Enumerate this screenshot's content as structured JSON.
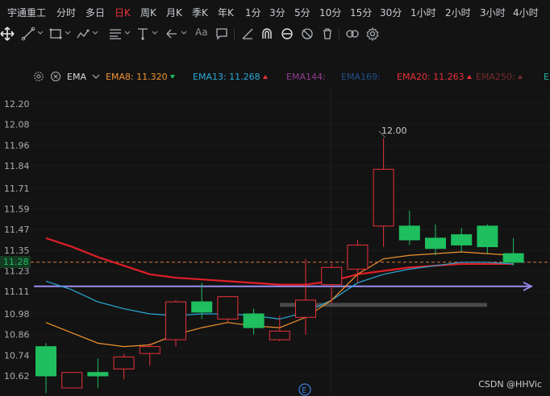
{
  "timeframes": [
    {
      "label": "宇通重工",
      "active": false
    },
    {
      "label": "分时",
      "active": false
    },
    {
      "label": "多日",
      "active": false
    },
    {
      "label": "日K",
      "active": true
    },
    {
      "label": "周K",
      "active": false
    },
    {
      "label": "月K",
      "active": false
    },
    {
      "label": "季K",
      "active": false
    },
    {
      "label": "年K",
      "active": false
    },
    {
      "label": "1分",
      "active": false
    },
    {
      "label": "3分",
      "active": false
    },
    {
      "label": "5分",
      "active": false
    },
    {
      "label": "10分",
      "active": false
    },
    {
      "label": "15分",
      "active": false
    },
    {
      "label": "30分",
      "active": false
    },
    {
      "label": "1小时",
      "active": false
    },
    {
      "label": "2小时",
      "active": false
    },
    {
      "label": "3小时",
      "active": false
    },
    {
      "label": "4小时",
      "active": false
    }
  ],
  "toolbar": {
    "tools": [
      "move-icon",
      "trend-line-icon",
      "rectangle-icon",
      "fibonacci-icon",
      "parallel-channel-icon",
      "price-line-icon",
      "arrow-left-icon",
      "text-tool-icon",
      "comment-icon",
      "ruler-icon",
      "magnet-icon",
      "link-icon",
      "hide-drawings-icon",
      "delete-icon",
      "overlay-icon",
      "settings-icon"
    ],
    "text_label": "Aa"
  },
  "legend": {
    "indicator": "EMA",
    "items": [
      {
        "name": "EMA8:",
        "value": "11.320",
        "trend": "down",
        "color": "#f0922e"
      },
      {
        "name": "EMA13:",
        "value": "11.268",
        "trend": "up",
        "color": "#29a9d8"
      },
      {
        "name": "EMA144:",
        "value": "",
        "trend": "",
        "color": "#8e3f8f"
      },
      {
        "name": "EMA169:",
        "value": "",
        "trend": "",
        "color": "#1f4f8a"
      },
      {
        "name": "EMA20:",
        "value": "11.263",
        "trend": "up",
        "color": "#e8313a"
      },
      {
        "name": "EMA250:",
        "value": "",
        "trend": "",
        "color": "#7a2a2a"
      },
      {
        "name": "E",
        "value": "",
        "trend": "",
        "color": "#29b3a3"
      }
    ]
  },
  "current_price": "11.28",
  "watermark": "CSDN @HHVic",
  "colors": {
    "up": "#e8313a",
    "down": "#1fbf5f",
    "background": "#131313",
    "grid": "#1f1f1f"
  },
  "chart_data": {
    "type": "candlestick",
    "y_ticks": [
      "12.20",
      "12.08",
      "11.96",
      "11.84",
      "11.71",
      "11.59",
      "11.47",
      "11.35",
      "11.23",
      "11.11",
      "10.98",
      "10.86",
      "10.74",
      "10.62"
    ],
    "high_marker": "12.00",
    "candles": [
      {
        "o": 10.62,
        "h": 10.81,
        "l": 10.52,
        "c": 10.79,
        "dir": "down"
      },
      {
        "o": 10.55,
        "h": 10.64,
        "l": 10.55,
        "c": 10.64,
        "dir": "up"
      },
      {
        "o": 10.62,
        "h": 10.72,
        "l": 10.55,
        "c": 10.64,
        "dir": "down"
      },
      {
        "o": 10.66,
        "h": 10.75,
        "l": 10.6,
        "c": 10.73,
        "dir": "up"
      },
      {
        "o": 10.75,
        "h": 10.81,
        "l": 10.68,
        "c": 10.79,
        "dir": "up"
      },
      {
        "o": 10.83,
        "h": 11.06,
        "l": 10.79,
        "c": 11.05,
        "dir": "up"
      },
      {
        "o": 11.05,
        "h": 11.16,
        "l": 10.95,
        "c": 10.99,
        "dir": "down"
      },
      {
        "o": 10.95,
        "h": 11.08,
        "l": 10.93,
        "c": 11.08,
        "dir": "up"
      },
      {
        "o": 10.98,
        "h": 11.01,
        "l": 10.86,
        "c": 10.9,
        "dir": "down"
      },
      {
        "o": 10.83,
        "h": 10.97,
        "l": 10.82,
        "c": 10.88,
        "dir": "up"
      },
      {
        "o": 10.96,
        "h": 11.3,
        "l": 10.86,
        "c": 11.06,
        "dir": "up"
      },
      {
        "o": 11.15,
        "h": 11.27,
        "l": 11.04,
        "c": 11.25,
        "dir": "up"
      },
      {
        "o": 11.24,
        "h": 11.41,
        "l": 11.16,
        "c": 11.38,
        "dir": "up"
      },
      {
        "o": 11.49,
        "h": 12.0,
        "l": 11.37,
        "c": 11.82,
        "dir": "up"
      },
      {
        "o": 11.49,
        "h": 11.58,
        "l": 11.38,
        "c": 11.41,
        "dir": "down"
      },
      {
        "o": 11.42,
        "h": 11.5,
        "l": 11.32,
        "c": 11.36,
        "dir": "down"
      },
      {
        "o": 11.44,
        "h": 11.48,
        "l": 11.34,
        "c": 11.38,
        "dir": "down"
      },
      {
        "o": 11.49,
        "h": 11.5,
        "l": 11.33,
        "c": 11.37,
        "dir": "down"
      },
      {
        "o": 11.33,
        "h": 11.42,
        "l": 11.26,
        "c": 11.28,
        "dir": "down"
      }
    ],
    "ema8": [
      10.93,
      10.87,
      10.81,
      10.79,
      10.8,
      10.86,
      10.9,
      10.93,
      10.91,
      10.9,
      10.96,
      11.06,
      11.21,
      11.3,
      11.32,
      11.33,
      11.34,
      11.33,
      11.32
    ],
    "ema13": [
      11.17,
      11.12,
      11.05,
      11.01,
      10.98,
      10.97,
      10.98,
      10.98,
      10.97,
      10.95,
      10.99,
      11.06,
      11.16,
      11.21,
      11.24,
      11.26,
      11.28,
      11.28,
      11.27
    ],
    "ema20": [
      11.42,
      11.37,
      11.31,
      11.26,
      11.21,
      11.19,
      11.18,
      11.17,
      11.16,
      11.15,
      11.15,
      11.17,
      11.21,
      11.23,
      11.25,
      11.26,
      11.27,
      11.27,
      11.27
    ],
    "horizontal_ray": 11.14,
    "support_band": 11.03
  }
}
